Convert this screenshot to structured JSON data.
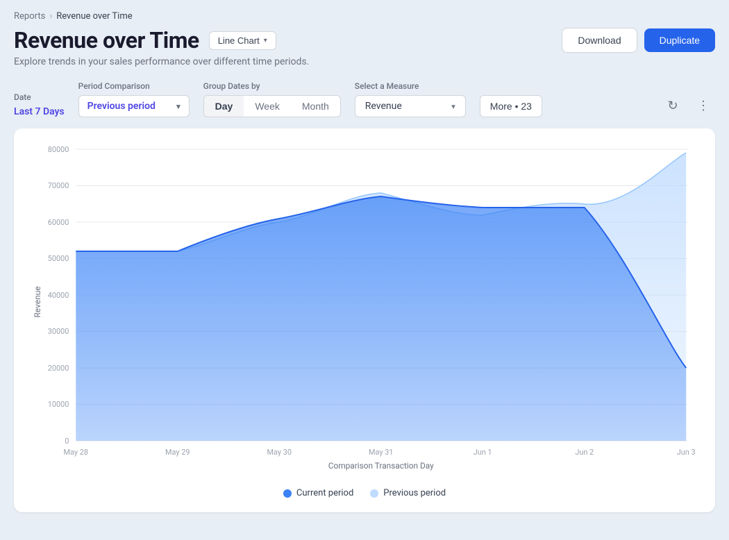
{
  "breadcrumb": {
    "parent": "Reports",
    "current": "Revenue over Time"
  },
  "page": {
    "title": "Revenue over Time",
    "subtitle": "Explore trends in your sales performance over different time periods.",
    "chart_type_label": "Line Chart"
  },
  "header_buttons": {
    "download": "Download",
    "duplicate": "Duplicate"
  },
  "filters": {
    "date_label": "Date",
    "date_value": "Last 7 Days",
    "period_label": "Period Comparison",
    "period_value": "Previous period",
    "group_label": "Group Dates by",
    "group_options": [
      "Day",
      "Week",
      "Month"
    ],
    "group_active": "Day",
    "measure_label": "Select a Measure",
    "measure_value": "Revenue",
    "more_label": "More • 23"
  },
  "chart": {
    "y_axis_label": "Revenue",
    "x_axis_label": "Comparison Transaction Day",
    "y_ticks": [
      0,
      10000,
      20000,
      30000,
      40000,
      50000,
      60000,
      70000,
      80000
    ],
    "x_labels": [
      "May 28",
      "May 29",
      "May 30",
      "May 31",
      "Jun 1",
      "Jun 2",
      "Jun 3"
    ],
    "legend": {
      "current": "Current period",
      "previous": "Previous period"
    },
    "colors": {
      "current_fill": "#3b82f6",
      "current_stroke": "#2563eb",
      "previous_fill": "#bfdbfe",
      "previous_stroke": "#93c5fd"
    }
  }
}
